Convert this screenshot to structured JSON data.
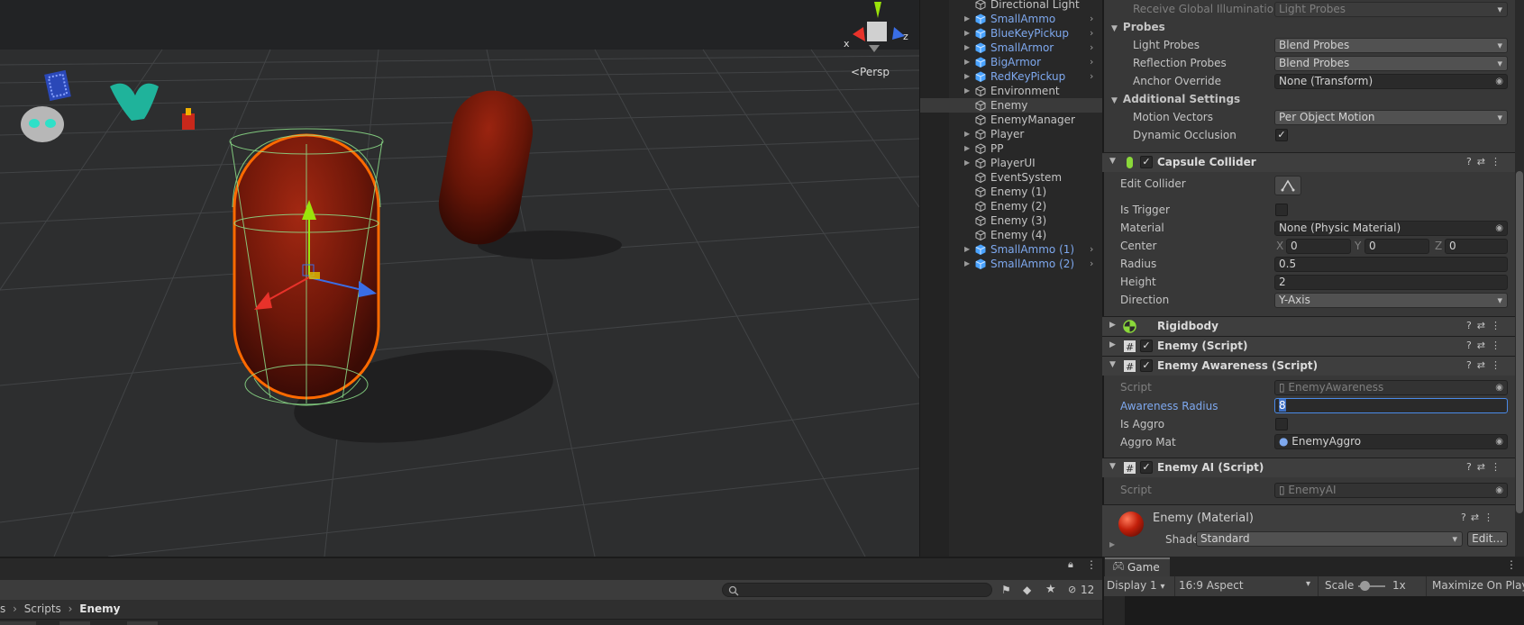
{
  "scene": {
    "persp_label": "<Persp",
    "gizmo_x": "x",
    "gizmo_z": "z"
  },
  "hierarchy": {
    "items": [
      {
        "label": "Directional Light",
        "prefab": false,
        "expandable": false
      },
      {
        "label": "SmallAmmo",
        "prefab": true,
        "expandable": true
      },
      {
        "label": "BlueKeyPickup",
        "prefab": true,
        "expandable": true
      },
      {
        "label": "SmallArmor",
        "prefab": true,
        "expandable": true
      },
      {
        "label": "BigArmor",
        "prefab": true,
        "expandable": true
      },
      {
        "label": "RedKeyPickup",
        "prefab": true,
        "expandable": true
      },
      {
        "label": "Environment",
        "prefab": false,
        "expandable": true
      },
      {
        "label": "Enemy",
        "prefab": false,
        "expandable": false,
        "selected": true
      },
      {
        "label": "EnemyManager",
        "prefab": false,
        "expandable": false
      },
      {
        "label": "Player",
        "prefab": false,
        "expandable": true
      },
      {
        "label": "PP",
        "prefab": false,
        "expandable": true
      },
      {
        "label": "PlayerUI",
        "prefab": false,
        "expandable": true
      },
      {
        "label": "EventSystem",
        "prefab": false,
        "expandable": false
      },
      {
        "label": "Enemy (1)",
        "prefab": false,
        "expandable": false
      },
      {
        "label": "Enemy (2)",
        "prefab": false,
        "expandable": false
      },
      {
        "label": "Enemy (3)",
        "prefab": false,
        "expandable": false
      },
      {
        "label": "Enemy (4)",
        "prefab": false,
        "expandable": false
      },
      {
        "label": "SmallAmmo (1)",
        "prefab": true,
        "expandable": true
      },
      {
        "label": "SmallAmmo (2)",
        "prefab": true,
        "expandable": true
      }
    ]
  },
  "inspector": {
    "receive_gi_label": "Receive Global Illumination",
    "receive_gi_value": "Light Probes",
    "probes_header": "Probes",
    "light_probes_label": "Light Probes",
    "light_probes_value": "Blend Probes",
    "reflection_probes_label": "Reflection Probes",
    "reflection_probes_value": "Blend Probes",
    "anchor_override_label": "Anchor Override",
    "anchor_override_value": "None (Transform)",
    "additional_header": "Additional Settings",
    "motion_vectors_label": "Motion Vectors",
    "motion_vectors_value": "Per Object Motion",
    "dynamic_occlusion_label": "Dynamic Occlusion",
    "dynamic_occlusion_checked": "✓",
    "capsule": {
      "title": "Capsule Collider",
      "edit_collider_label": "Edit Collider",
      "is_trigger_label": "Is Trigger",
      "material_label": "Material",
      "material_value": "None (Physic Material)",
      "center_label": "Center",
      "x_label": "X",
      "x_value": "0",
      "y_label": "Y",
      "y_value": "0",
      "z_label": "Z",
      "z_value": "0",
      "radius_label": "Radius",
      "radius_value": "0.5",
      "height_label": "Height",
      "height_value": "2",
      "direction_label": "Direction",
      "direction_value": "Y-Axis"
    },
    "rigidbody_title": "Rigidbody",
    "enemy_script_title": "Enemy (Script)",
    "awareness": {
      "title": "Enemy Awareness (Script)",
      "script_label": "Script",
      "script_value": "EnemyAwareness",
      "radius_label": "Awareness Radius",
      "radius_value": "8",
      "is_aggro_label": "Is Aggro",
      "aggro_mat_label": "Aggro Mat",
      "aggro_mat_value": "EnemyAggro"
    },
    "ai": {
      "title": "Enemy AI (Script)",
      "script_label": "Script",
      "script_value": "EnemyAI"
    },
    "material": {
      "title": "Enemy (Material)",
      "shader_label": "Shader",
      "shader_value": "Standard",
      "edit_label": "Edit..."
    },
    "header_icons": "?⇄⋮"
  },
  "project": {
    "hidden_count": "12",
    "breadcrumb": [
      "s",
      "Scripts",
      "Enemy"
    ]
  },
  "game": {
    "tab_label": "Game",
    "display_value": "Display 1",
    "aspect_value": "16:9 Aspect",
    "scale_label": "Scale",
    "scale_value": "1x",
    "maximize_label": "Maximize On Play"
  },
  "colors": {
    "selection_orange": "#ff6a00",
    "prefab_blue": "#7ea8ee",
    "enemy_red": "#7a1508"
  }
}
